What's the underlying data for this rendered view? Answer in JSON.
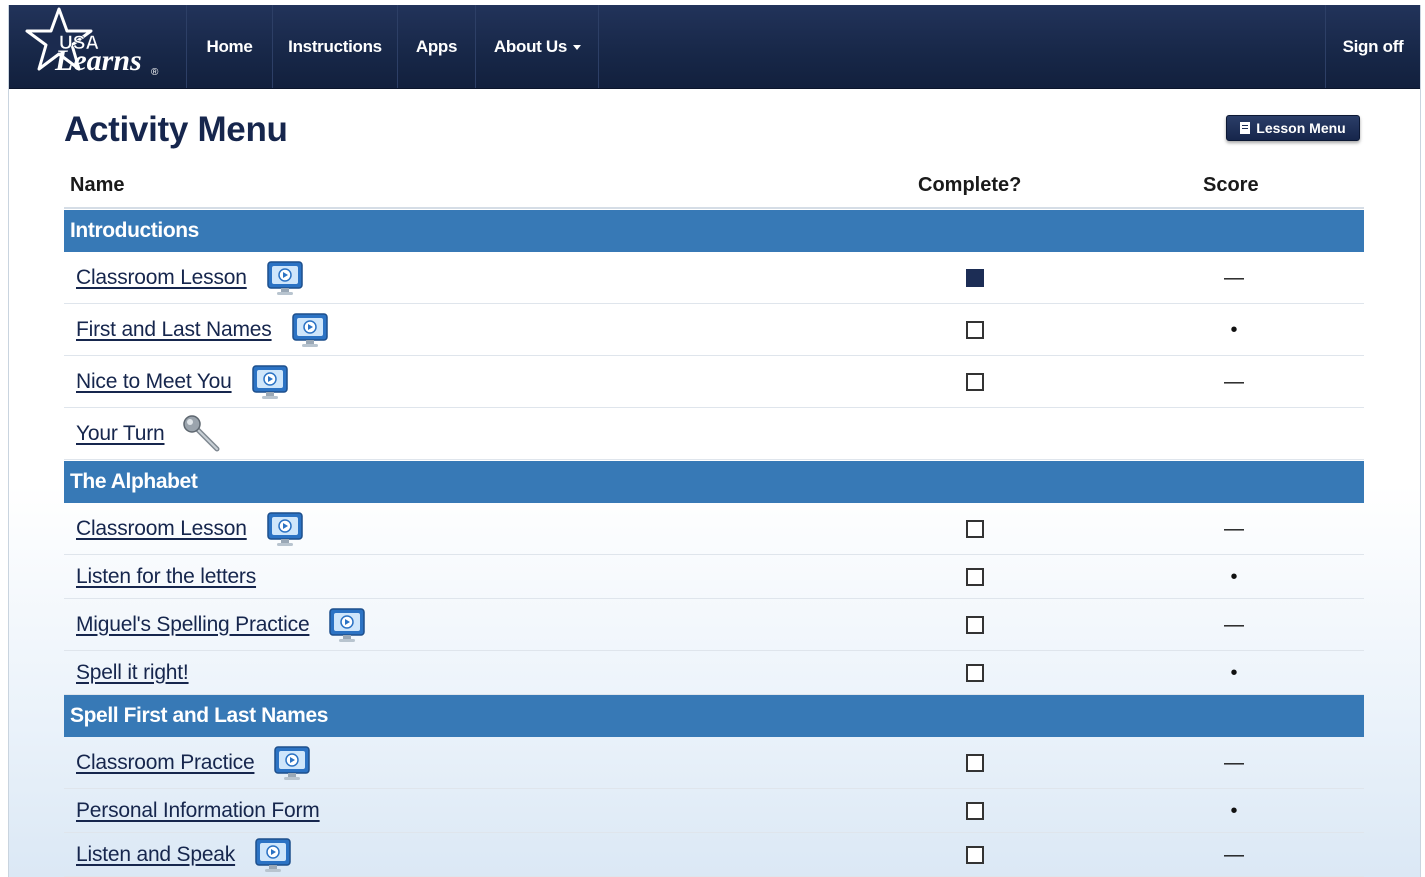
{
  "nav": {
    "logo": {
      "top_text": "USA",
      "bottom_text": "Learns",
      "registered": "®"
    },
    "items": [
      {
        "label": "Home"
      },
      {
        "label": "Instructions"
      },
      {
        "label": "Apps"
      },
      {
        "label": "About Us",
        "has_dropdown": true
      }
    ],
    "sign_off": "Sign off"
  },
  "page": {
    "title": "Activity Menu",
    "lesson_menu_button": "Lesson Menu"
  },
  "table": {
    "headers": {
      "name": "Name",
      "complete": "Complete?",
      "score": "Score"
    },
    "sections": [
      {
        "title": "Introductions",
        "rows": [
          {
            "name": "Classroom Lesson",
            "icon": "video-icon",
            "complete": true,
            "score": "—"
          },
          {
            "name": "First and Last Names",
            "icon": "video-icon",
            "complete": false,
            "score": "•"
          },
          {
            "name": "Nice to Meet You",
            "icon": "video-icon",
            "complete": false,
            "score": "—"
          },
          {
            "name": "Your Turn",
            "icon": "microphone-icon",
            "complete": null,
            "score": ""
          }
        ]
      },
      {
        "title": "The Alphabet",
        "rows": [
          {
            "name": "Classroom Lesson",
            "icon": "video-icon",
            "complete": false,
            "score": "—"
          },
          {
            "name": "Listen for the letters",
            "icon": "",
            "complete": false,
            "score": "•"
          },
          {
            "name": "Miguel's Spelling Practice",
            "icon": "video-icon",
            "complete": false,
            "score": "—"
          },
          {
            "name": "Spell it right!",
            "icon": "",
            "complete": false,
            "score": "•"
          }
        ]
      },
      {
        "title": "Spell First and Last Names",
        "rows": [
          {
            "name": "Classroom Practice",
            "icon": "video-icon",
            "complete": false,
            "score": "—"
          },
          {
            "name": "Personal Information Form",
            "icon": "",
            "complete": false,
            "score": "•"
          },
          {
            "name": "Listen and Speak",
            "icon": "video-icon",
            "complete": false,
            "score": "—"
          }
        ]
      }
    ]
  },
  "colors": {
    "nav_background": "#1b2b4f",
    "title_navy": "#16264d",
    "section_blue": "#3779b6"
  }
}
